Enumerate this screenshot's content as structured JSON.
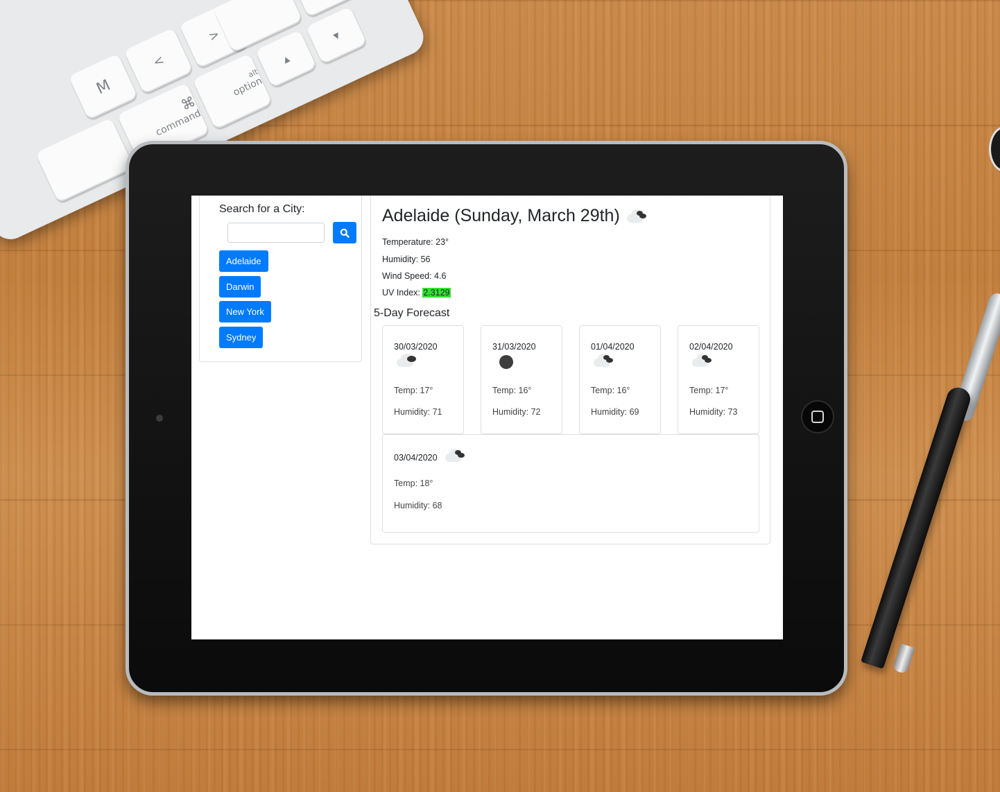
{
  "search": {
    "title": "Search for a City:",
    "input_value": "",
    "search_button_icon": "search-icon"
  },
  "cities": [
    "Adelaide",
    "Darwin",
    "New York",
    "Sydney"
  ],
  "current": {
    "city_title": "Adelaide (Sunday, March 29th)",
    "weather_icon": "broken-clouds-icon",
    "temperature": "Temperature: 23°",
    "humidity": "Humidity: 56",
    "wind_speed": "Wind Speed: 4.6",
    "uv_label": "UV Index:",
    "uv_value": "2.3129",
    "uv_color": "#32e032"
  },
  "forecast": {
    "title": "5-Day Forecast",
    "days": [
      {
        "date": "30/03/2020",
        "icon": "few-clouds-icon",
        "temp": "Temp: 17°",
        "humidity": "Humidity: 71"
      },
      {
        "date": "31/03/2020",
        "icon": "clear-sky-icon",
        "temp": "Temp: 16°",
        "humidity": "Humidity: 72"
      },
      {
        "date": "01/04/2020",
        "icon": "broken-clouds-icon",
        "temp": "Temp: 16°",
        "humidity": "Humidity: 69"
      },
      {
        "date": "02/04/2020",
        "icon": "broken-clouds-icon",
        "temp": "Temp: 17°",
        "humidity": "Humidity: 73"
      },
      {
        "date": "03/04/2020",
        "icon": "broken-clouds-icon",
        "temp": "Temp: 18°",
        "humidity": "Humidity: 68"
      }
    ]
  },
  "keyboard": {
    "keys": [
      "M",
      "<",
      ">",
      "⌘",
      "command",
      "alt",
      "option",
      "▲",
      "▼"
    ]
  },
  "colors": {
    "primary": "#007bff",
    "uv_badge": "#32e032",
    "text": "#212529"
  }
}
